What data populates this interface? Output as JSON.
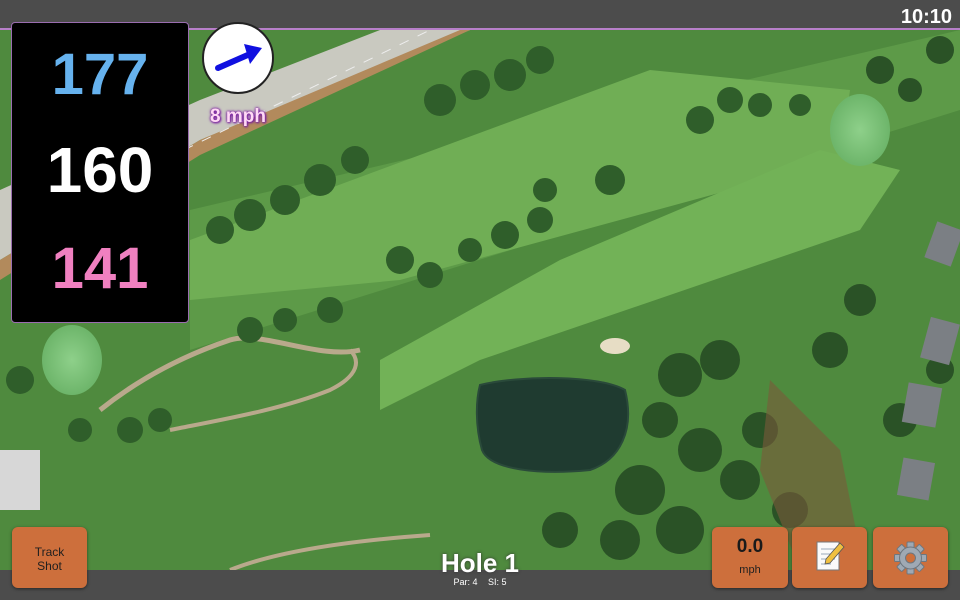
{
  "status_bar": {
    "time": "10:10"
  },
  "distances": {
    "back": "177",
    "middle": "160",
    "front": "141"
  },
  "wind": {
    "speed": "8 mph",
    "direction_icon": "arrow-right-up-icon"
  },
  "hole": {
    "title": "Hole 1",
    "par": "Par: 4",
    "stroke_index": "SI: 5"
  },
  "buttons": {
    "track_shot_line1": "Track",
    "track_shot_line2": "Shot",
    "speed_value": "0.0",
    "speed_unit": "mph",
    "notes_icon": "notepad-pencil-icon",
    "settings_icon": "gear-icon"
  },
  "colors": {
    "back_distance": "#66b2ee",
    "middle_distance": "#ffffff",
    "front_distance": "#f080c0",
    "button": "#cd6f3c",
    "accent": "#b77fc9"
  }
}
